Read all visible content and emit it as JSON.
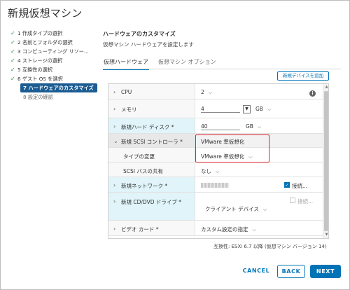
{
  "title": "新規仮想マシン",
  "steps": [
    {
      "label": "1 作成タイプの選択",
      "state": "done"
    },
    {
      "label": "2 名前とフォルダの選択",
      "state": "done"
    },
    {
      "label": "3 コンピューティング リソー...",
      "state": "done"
    },
    {
      "label": "4 ストレージの選択",
      "state": "done"
    },
    {
      "label": "5 互換性の選択",
      "state": "done"
    },
    {
      "label": "6 ゲスト OS を選択",
      "state": "done"
    },
    {
      "label": "7 ハードウェアのカスタマイズ",
      "state": "active"
    },
    {
      "label": "8 設定の確認",
      "state": "pending"
    }
  ],
  "section": {
    "title": "ハードウェアのカスタマイズ",
    "subtitle": "仮想マシン ハードウェアを設定します"
  },
  "tabs": [
    {
      "label": "仮想ハードウェア",
      "active": true
    },
    {
      "label": "仮想マシン オプション",
      "active": false
    }
  ],
  "add_device_label": "新規デバイスを追加",
  "hardware": {
    "cpu": {
      "label": "CPU",
      "value": "2"
    },
    "memory": {
      "label": "メモリ",
      "value": "4",
      "unit": "GB"
    },
    "disk": {
      "label": "新規ハード ディスク *",
      "value": "40",
      "unit": "GB"
    },
    "scsi": {
      "label": "新規 SCSI コントローラ *",
      "value": "VMware 準仮想化"
    },
    "scsi_type": {
      "label": "タイプの変更",
      "value": "VMware 準仮想化"
    },
    "scsi_bus": {
      "label": "SCSI バスの共有",
      "value": "なし"
    },
    "network": {
      "label": "新規ネットワーク *",
      "connect_label": "接続...",
      "connected": true
    },
    "cddvd": {
      "label": "新規 CD/DVD ドライブ *",
      "value": "クライアント デバイス",
      "connect_label": "接続...",
      "connected": false
    },
    "video": {
      "label": "ビデオ カード *",
      "value": "カスタム設定の指定"
    }
  },
  "compatibility": "互換性: ESXi 6.7 以降 (仮想マシン バージョン 14)",
  "buttons": {
    "cancel": "CANCEL",
    "back": "BACK",
    "next": "NEXT"
  },
  "colors": {
    "accent": "#0073b7",
    "active_step": "#1b5c92",
    "check": "#2f8b3e",
    "highlight_box": "#d9262c"
  }
}
